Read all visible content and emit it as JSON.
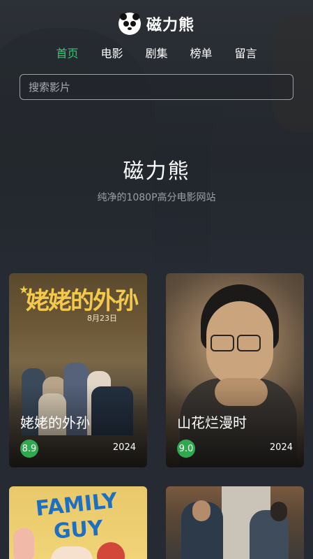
{
  "app": {
    "brand": "磁力熊"
  },
  "nav": {
    "items": [
      "首页",
      "电影",
      "剧集",
      "榜单",
      "留言"
    ],
    "active_index": 0
  },
  "search": {
    "placeholder": "搜索影片"
  },
  "hero": {
    "title": "磁力熊",
    "subtitle": "纯净的1080P高分电影网站"
  },
  "movies": [
    {
      "title": "姥姥的外孙",
      "rating": "8.9",
      "year": "2024",
      "poster_title": "姥姥的外孙",
      "poster_date": "8月23日"
    },
    {
      "title": "山花烂漫时",
      "rating": "9.0",
      "year": "2024"
    },
    {
      "poster_title_line1": "FAMILY",
      "poster_title_line2": "GUY"
    },
    {}
  ],
  "colors": {
    "accent": "#2ecc71",
    "rating_badge": "#2fa84f",
    "background": "#262b33"
  }
}
